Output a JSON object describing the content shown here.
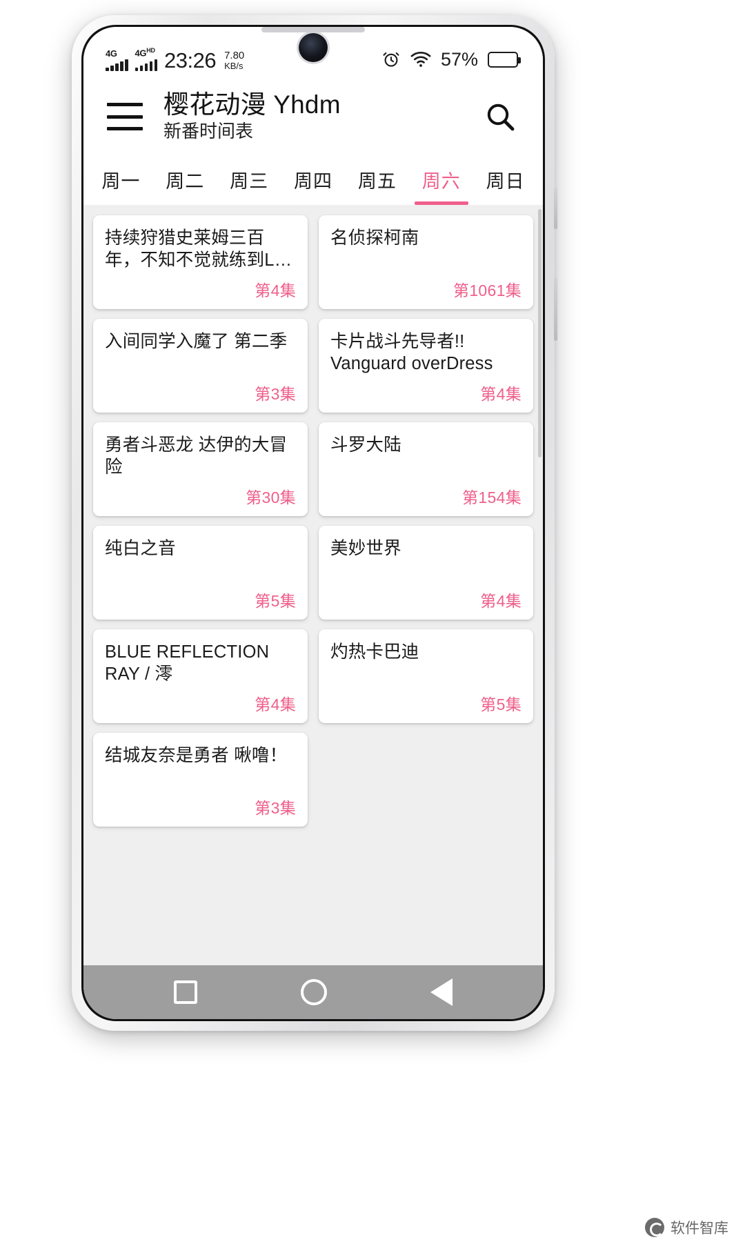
{
  "statusbar": {
    "network_primary": "4G",
    "network_secondary": "4G",
    "network_secondary_sup": "HD",
    "time": "23:26",
    "netspeed_value": "7.80",
    "netspeed_unit": "KB/s",
    "alarm_icon": "alarm-clock-icon",
    "wifi_icon": "wifi-icon",
    "battery_percent": "57%"
  },
  "appbar": {
    "menu_icon": "hamburger-menu-icon",
    "title": "樱花动漫 Yhdm",
    "subtitle": "新番时间表",
    "search_icon": "search-icon"
  },
  "tabs": {
    "active_index": 5,
    "items": [
      {
        "label": "周一"
      },
      {
        "label": "周二"
      },
      {
        "label": "周三"
      },
      {
        "label": "周四"
      },
      {
        "label": "周五"
      },
      {
        "label": "周六"
      },
      {
        "label": "周日"
      }
    ]
  },
  "accent_color": "#ef5f8c",
  "cards": [
    {
      "title": "持续狩猎史莱姆三百年，不知不觉就练到L…",
      "episode": "第4集"
    },
    {
      "title": "名侦探柯南",
      "episode": "第1061集"
    },
    {
      "title": "入间同学入魔了 第二季",
      "episode": "第3集"
    },
    {
      "title": "卡片战斗先导者!! Vanguard overDress",
      "episode": "第4集"
    },
    {
      "title": "勇者斗恶龙 达伊的大冒险",
      "episode": "第30集"
    },
    {
      "title": "斗罗大陆",
      "episode": "第154集"
    },
    {
      "title": "纯白之音",
      "episode": "第5集"
    },
    {
      "title": "美妙世界",
      "episode": "第4集"
    },
    {
      "title": "BLUE REFLECTION RAY / 澪",
      "episode": "第4集"
    },
    {
      "title": "灼热卡巴迪",
      "episode": "第5集"
    },
    {
      "title": "结城友奈是勇者 啾噜！",
      "episode": "第3集"
    }
  ],
  "navbar": {
    "recents_icon": "square-recents-icon",
    "home_icon": "circle-home-icon",
    "back_icon": "triangle-back-icon"
  },
  "watermark": {
    "label": "软件智库",
    "logo_icon": "watermark-logo-icon"
  }
}
